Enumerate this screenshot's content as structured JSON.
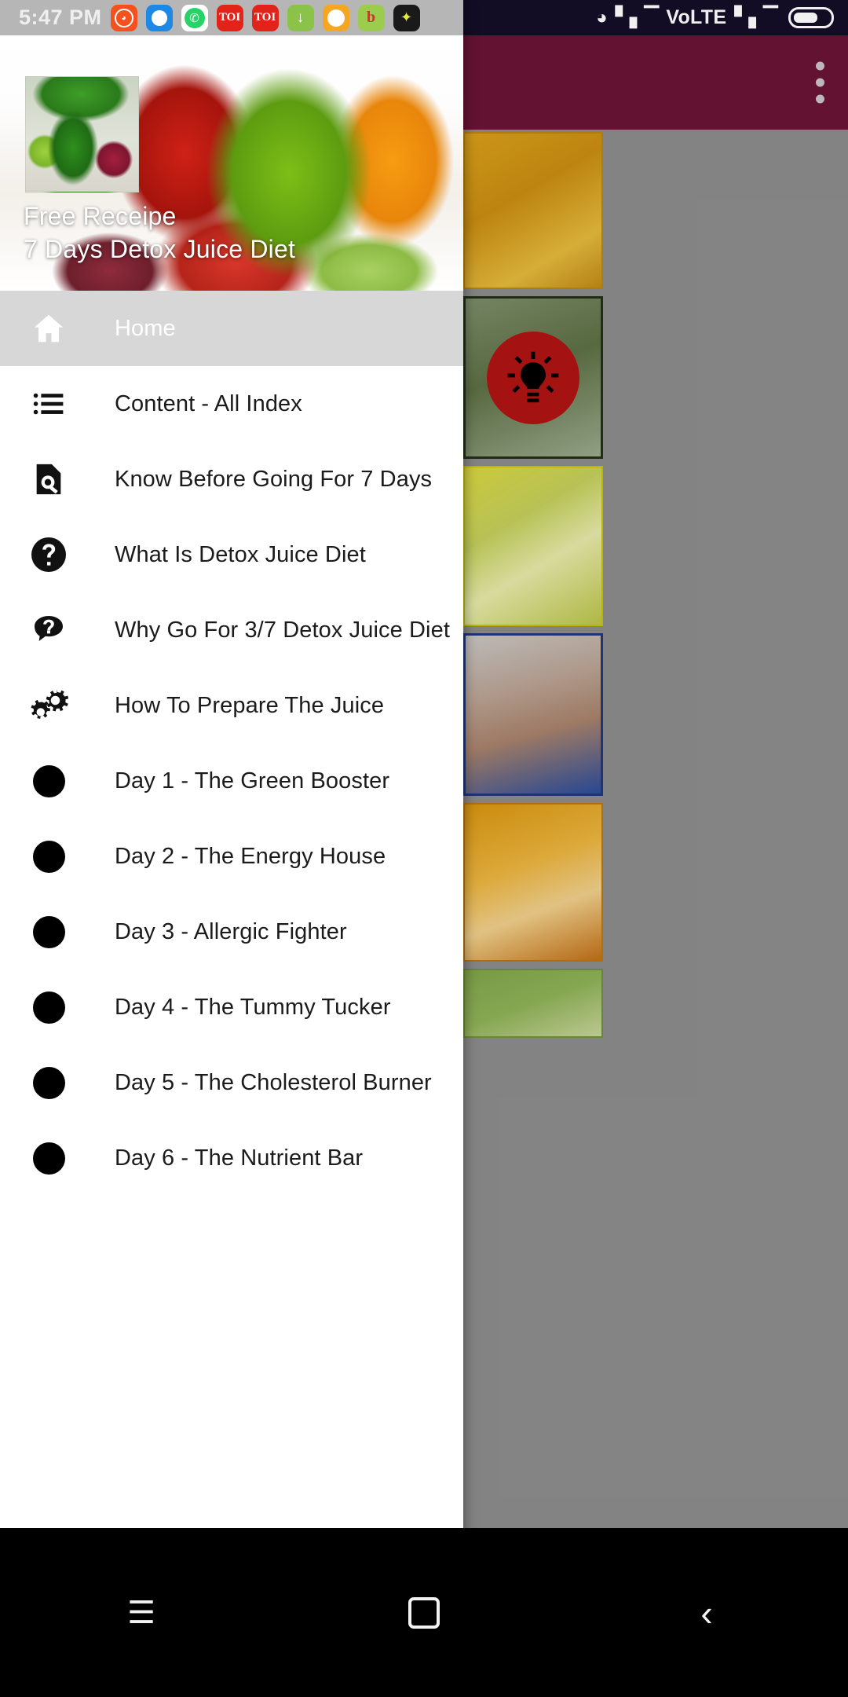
{
  "status_bar": {
    "clock": "5:47 PM",
    "tray_icons": [
      "mi-app-icon",
      "browser-icon",
      "whatsapp-icon",
      "toi-news-icon",
      "toi-news-icon",
      "download-icon",
      "messages-icon",
      "bigbasket-icon",
      "star-app-icon"
    ],
    "network_label": "VoLTE",
    "wifi_icon": "wifi-icon",
    "signal_icon": "signal-bars-icon",
    "battery_icon": "battery-icon"
  },
  "app_bar": {
    "overflow_icon": "overflow-menu-icon"
  },
  "background_cards": [
    {
      "name": "orange-juice-card"
    },
    {
      "name": "tip-bulb-card",
      "badge_icon": "lightbulb-icon"
    },
    {
      "name": "green-drink-card"
    },
    {
      "name": "arm-card"
    },
    {
      "name": "smoothie-card"
    },
    {
      "name": "cucumber-card"
    }
  ],
  "drawer": {
    "header": {
      "title": "Free Receipe",
      "subtitle": "7 Days Detox Juice Diet",
      "photo_name": "juice-glasses-photo",
      "inset_photo_name": "green-juice-inset-photo"
    },
    "items": [
      {
        "label": "Home",
        "icon": "home-icon",
        "selected": true
      },
      {
        "label": "Content - All Index",
        "icon": "list-icon",
        "selected": false
      },
      {
        "label": "Know Before Going For 7 Days",
        "icon": "document-search-icon",
        "selected": false
      },
      {
        "label": "What Is Detox Juice Diet",
        "icon": "question-circle-icon",
        "selected": false
      },
      {
        "label": "Why Go For 3/7 Detox Juice Diet",
        "icon": "question-bubble-icon",
        "selected": false
      },
      {
        "label": "How To Prepare The Juice",
        "icon": "gears-icon",
        "selected": false
      },
      {
        "label": "Day 1 - The Green Booster",
        "icon": "bullet-dot-icon",
        "selected": false
      },
      {
        "label": "Day 2 - The Energy House",
        "icon": "bullet-dot-icon",
        "selected": false
      },
      {
        "label": "Day 3 - Allergic  Fighter",
        "icon": "bullet-dot-icon",
        "selected": false
      },
      {
        "label": "Day 4 - The Tummy Tucker",
        "icon": "bullet-dot-icon",
        "selected": false
      },
      {
        "label": "Day 5 - The Cholesterol Burner",
        "icon": "bullet-dot-icon",
        "selected": false
      },
      {
        "label": "Day 6 - The Nutrient Bar",
        "icon": "bullet-dot-icon",
        "selected": false
      }
    ]
  },
  "system_nav": {
    "recents_icon": "recents-icon",
    "home_icon": "home-square-icon",
    "back_icon": "back-chevron-icon"
  },
  "colors": {
    "app_bar": "#6b1435",
    "drawer_selected": "#d7d7d7",
    "status_bar": "#140d28",
    "drawer_status_bar": "#b6b6b6"
  }
}
